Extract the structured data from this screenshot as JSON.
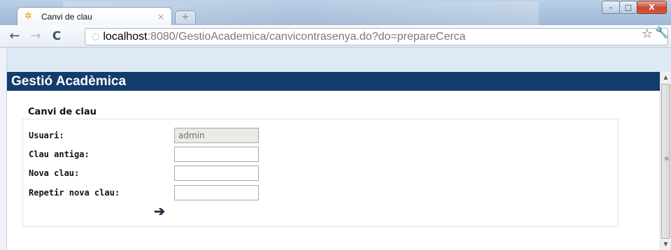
{
  "browser": {
    "tab_title": "Canvi de clau",
    "tab_close": "×",
    "new_tab": "+",
    "url_host": "localhost",
    "url_rest": ":8080/GestioAcademica/canvicontrasenya.do?do=prepareCerca",
    "icons": {
      "back": "back-arrow-icon",
      "forward": "forward-arrow-icon",
      "reload": "reload-icon",
      "bookmark": "star-icon",
      "menu": "wrench-icon"
    }
  },
  "window_controls": {
    "minimize": "–",
    "maximize": "□",
    "close": "X"
  },
  "page": {
    "header_title": "Gestió Acadèmica",
    "section_title": "Canvi de clau",
    "fields": [
      {
        "label": "Usuari:",
        "value": "admin",
        "disabled": true
      },
      {
        "label": "Clau antiga:",
        "value": ""
      },
      {
        "label": "Nova clau:",
        "value": ""
      },
      {
        "label": "Repetir nova clau:",
        "value": ""
      }
    ],
    "submit_icon": "arrow-right-icon"
  }
}
